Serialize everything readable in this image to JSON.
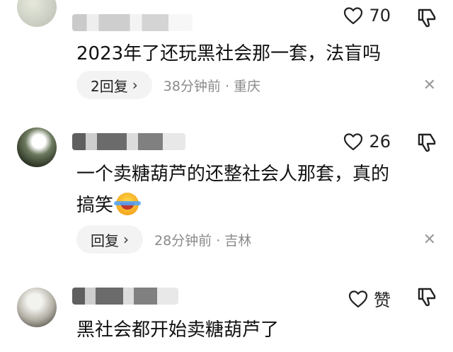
{
  "comments": [
    {
      "likes": "70",
      "text": "2023年了还玩黑社会那一套，法盲吗",
      "reply_label": "2回复",
      "time_location": "38分钟前 · 重庆"
    },
    {
      "likes": "26",
      "text_line1": "一个卖糖葫芦的还整社会人那套，真的",
      "text_line2": "搞笑",
      "reply_label": "回复",
      "time_location": "28分钟前 · 吉林"
    },
    {
      "likes": "赞",
      "text": "黑社会都开始卖糖葫芦了"
    }
  ],
  "icons": {
    "like": "heart-icon",
    "dislike": "thumbs-down-icon",
    "close": "close-icon",
    "chevron": "chevron-right-icon",
    "emoji": "laughing-crying-emoji"
  },
  "ui": {
    "close_glyph": "✕",
    "chevron_glyph": "›"
  }
}
